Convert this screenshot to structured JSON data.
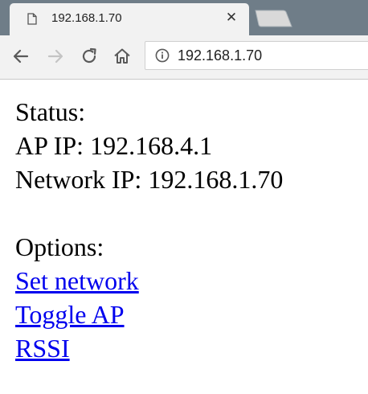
{
  "tab": {
    "title": "192.168.1.70",
    "close_glyph": "✕",
    "favicon": "document-icon"
  },
  "toolbar": {
    "back_icon": "arrow-left-icon",
    "forward_icon": "arrow-right-icon",
    "reload_icon": "reload-icon",
    "home_icon": "home-icon"
  },
  "omnibox": {
    "icon": "info-icon",
    "url": "192.168.1.70"
  },
  "page": {
    "status_heading": "Status:",
    "ap_ip": "AP IP: 192.168.4.1",
    "network_ip": "Network IP: 192.168.1.70",
    "options_heading": "Options:",
    "links": [
      {
        "label": "Set network"
      },
      {
        "label": "Toggle AP"
      },
      {
        "label": "RSSI"
      }
    ]
  },
  "colors": {
    "tabstrip": "#6f7d88",
    "toolbar": "#f2f2f2",
    "link": "#0000ee"
  }
}
